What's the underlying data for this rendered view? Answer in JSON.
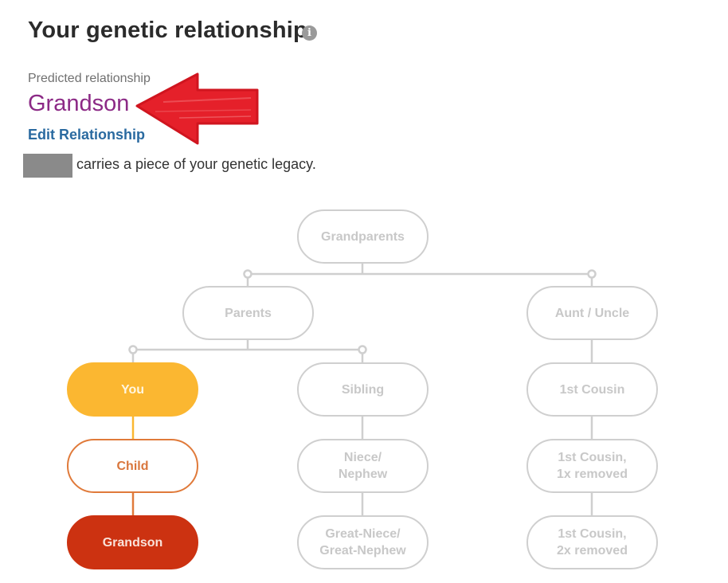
{
  "header": {
    "title": "Your genetic relationship",
    "info_icon": "info-icon"
  },
  "prediction": {
    "label": "Predicted relationship",
    "value": "Grandson",
    "edit_link": "Edit Relationship",
    "legacy_text": "carries a piece of your genetic legacy.",
    "redacted_name": true,
    "annotation_arrow": "red-arrow-pointing-left"
  },
  "colors": {
    "predicted_value": "#8c2a86",
    "edit_link": "#2a6aa0",
    "you_node": "#fbb731",
    "child_node": "#e07a3a",
    "grandson_node": "#cc3211",
    "inactive_node": "#cfcfcf",
    "arrow": "#e5202a"
  },
  "tree": {
    "grandparents": {
      "label": "Grandparents"
    },
    "parents": {
      "label": "Parents"
    },
    "aunt_uncle": {
      "label": "Aunt / Uncle"
    },
    "you": {
      "label": "You"
    },
    "sibling": {
      "label": "Sibling"
    },
    "first_cousin": {
      "label": "1st Cousin"
    },
    "child": {
      "label": "Child"
    },
    "niece_nephew": {
      "line1": "Niece/",
      "line2": "Nephew"
    },
    "first_cousin_1x": {
      "line1": "1st Cousin,",
      "line2": "1x removed"
    },
    "grandson": {
      "label": "Grandson"
    },
    "great_niece_nephew": {
      "line1": "Great-Niece/",
      "line2": "Great-Nephew"
    },
    "first_cousin_2x": {
      "line1": "1st Cousin,",
      "line2": "2x removed"
    }
  }
}
